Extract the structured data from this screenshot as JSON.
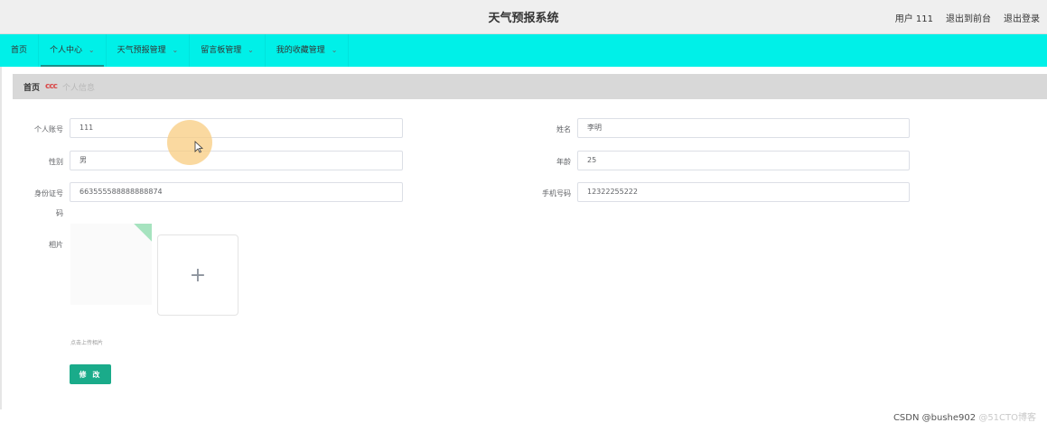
{
  "header": {
    "app_title": "天气预报系统",
    "user_label": "用户 111",
    "back_to_front": "退出到前台",
    "logout": "退出登录"
  },
  "nav": {
    "items": [
      {
        "label": "首页",
        "has_dropdown": false
      },
      {
        "label": "个人中心",
        "has_dropdown": true,
        "active": true
      },
      {
        "label": "天气预报管理",
        "has_dropdown": true
      },
      {
        "label": "留言板管理",
        "has_dropdown": true
      },
      {
        "label": "我的收藏管理",
        "has_dropdown": true
      }
    ],
    "chevron": "⌄"
  },
  "breadcrumb": {
    "home": "首页",
    "separator": "ccc",
    "current": "个人信息"
  },
  "form": {
    "account_label": "个人账号",
    "account_value": "111",
    "name_label": "姓名",
    "name_value": "李明",
    "gender_label": "性别",
    "gender_value": "男",
    "age_label": "年龄",
    "age_value": "25",
    "idcard_label_1": "身份证号",
    "idcard_label_2": "码",
    "idcard_value": "663555588888888874",
    "phone_label": "手机号码",
    "phone_value": "12322255222",
    "photo_label": "相片",
    "upload_plus": "+",
    "upload_hint": "点击上传相片",
    "submit_label": "修 改"
  },
  "watermark": {
    "text_a": "CSDN @bushe902",
    "text_b": "@51CTO博客"
  },
  "colors": {
    "nav_bg": "#00f0e8",
    "submit_bg": "#1aab8a",
    "breadcrumb_bg": "#d8d8d8"
  }
}
